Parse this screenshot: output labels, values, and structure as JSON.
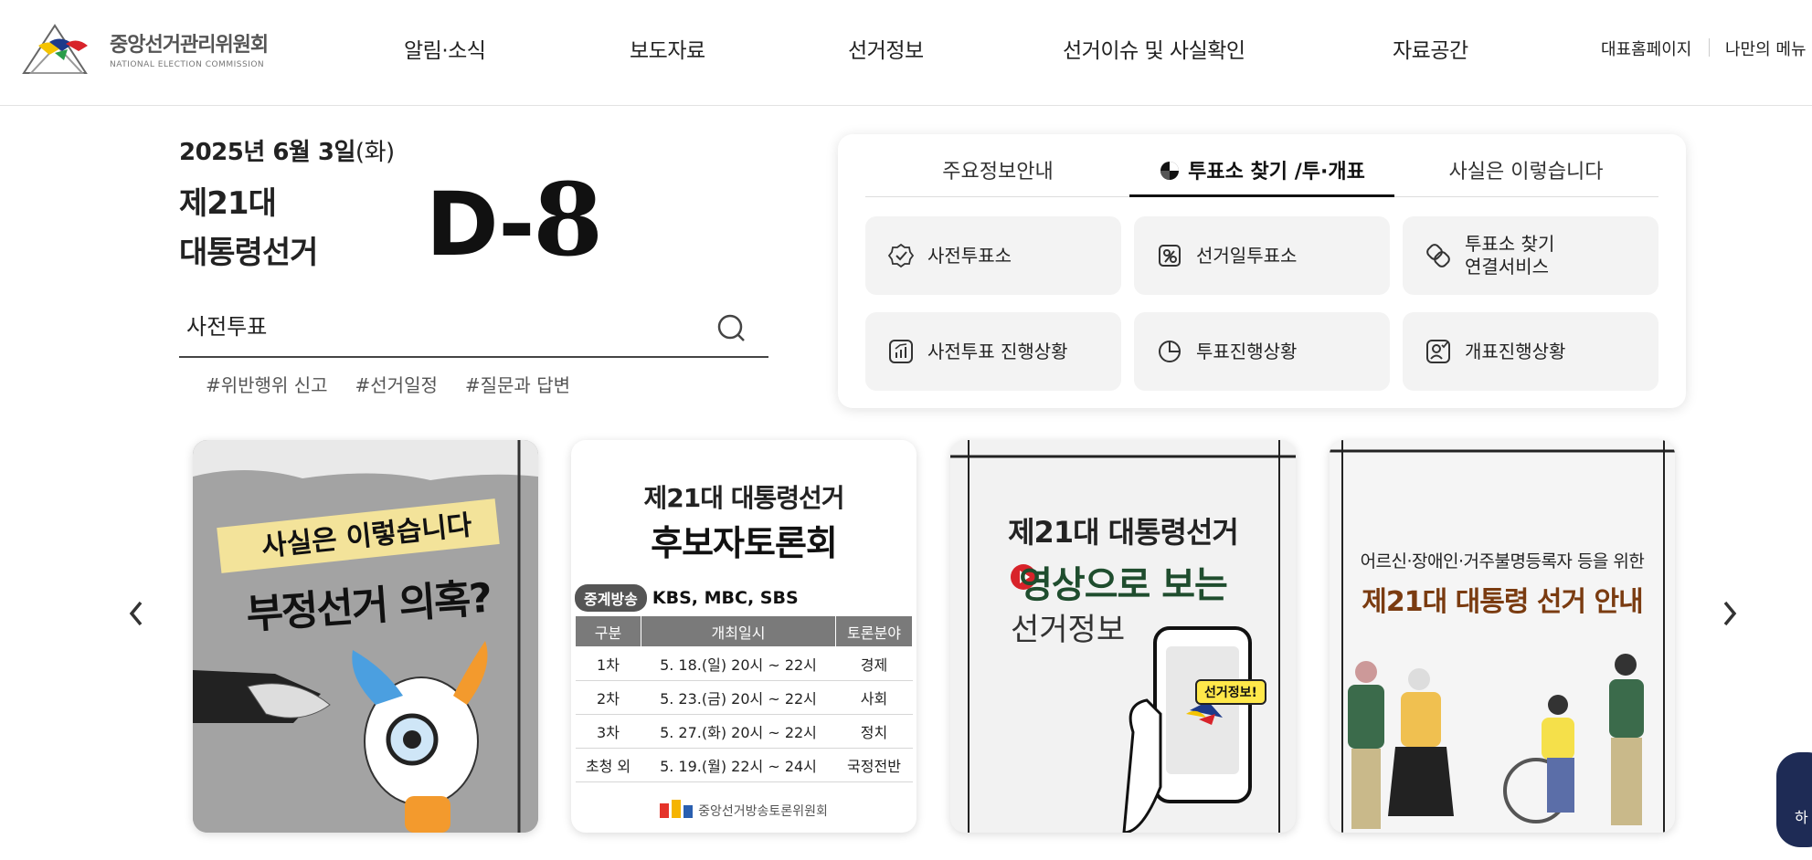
{
  "header": {
    "logo_ko": "중앙선거관리위원회",
    "logo_en": "NATIONAL ELECTION COMMISSION",
    "nav": [
      "알림·소식",
      "보도자료",
      "선거정보",
      "선거이슈 및 사실확인",
      "자료공간"
    ],
    "util": [
      "대표홈페이지",
      "나만의 메뉴"
    ]
  },
  "election": {
    "date_prefix": "2025년 6월 3일",
    "day": "(화)",
    "title_line1": "제21대",
    "title_line2": "대통령선거",
    "dday_prefix": "D-",
    "dday_num": "8"
  },
  "search": {
    "value": "사전투표"
  },
  "tags": [
    "#위반행위 신고",
    "#선거일정",
    "#질문과 답변"
  ],
  "info": {
    "tabs": [
      "주요정보안내",
      "투표소 찾기 /투·개표",
      "사실은 이렇습니다"
    ],
    "active_tab": 1,
    "buttons": [
      {
        "label": "사전투표소",
        "icon": "check-circle-icon"
      },
      {
        "label": "선거일투표소",
        "icon": "ballot-box-icon"
      },
      {
        "label": "투표소 찾기\n연결서비스",
        "icon": "link-icon"
      },
      {
        "label": "사전투표 진행상황",
        "icon": "bar-chart-icon"
      },
      {
        "label": "투표진행상황",
        "icon": "pie-chart-icon"
      },
      {
        "label": "개표진행상황",
        "icon": "person-check-icon"
      }
    ]
  },
  "banners": {
    "b1": {
      "line1": "사실은 이렇습니다",
      "line2": "부정선거 의혹?"
    },
    "b2": {
      "line1": "제21대  대통령선거",
      "line2": "후보자토론회",
      "broadcast_label": "중계방송",
      "broadcast_value": "KBS, MBC, SBS",
      "headers": [
        "구분",
        "개최일시",
        "토론분야"
      ],
      "rows": [
        [
          "1차",
          "5. 18.(일) 20시 ~ 22시",
          "경제"
        ],
        [
          "2차",
          "5. 23.(금) 20시 ~ 22시",
          "사회"
        ],
        [
          "3차",
          "5. 27.(화) 20시 ~ 22시",
          "정치"
        ],
        [
          "초청 외",
          "5. 19.(월) 22시 ~ 24시",
          "국정전반"
        ]
      ],
      "footer": "중앙선거방송토론위원회"
    },
    "b3": {
      "line1": "제21대 대통령선거",
      "line2": "영상으로 보는",
      "line3": "선거정보",
      "badge": "선거정보!"
    },
    "b4": {
      "line1": "어르신·장애인·거주불명등록자 등을 위한",
      "line2": "제21대 대통령 선거 안내"
    }
  },
  "float_btn": {
    "label": "하"
  },
  "colors": {
    "accent": "#111111",
    "button_bg": "#f3f3f3",
    "float": "#1e2b55"
  }
}
